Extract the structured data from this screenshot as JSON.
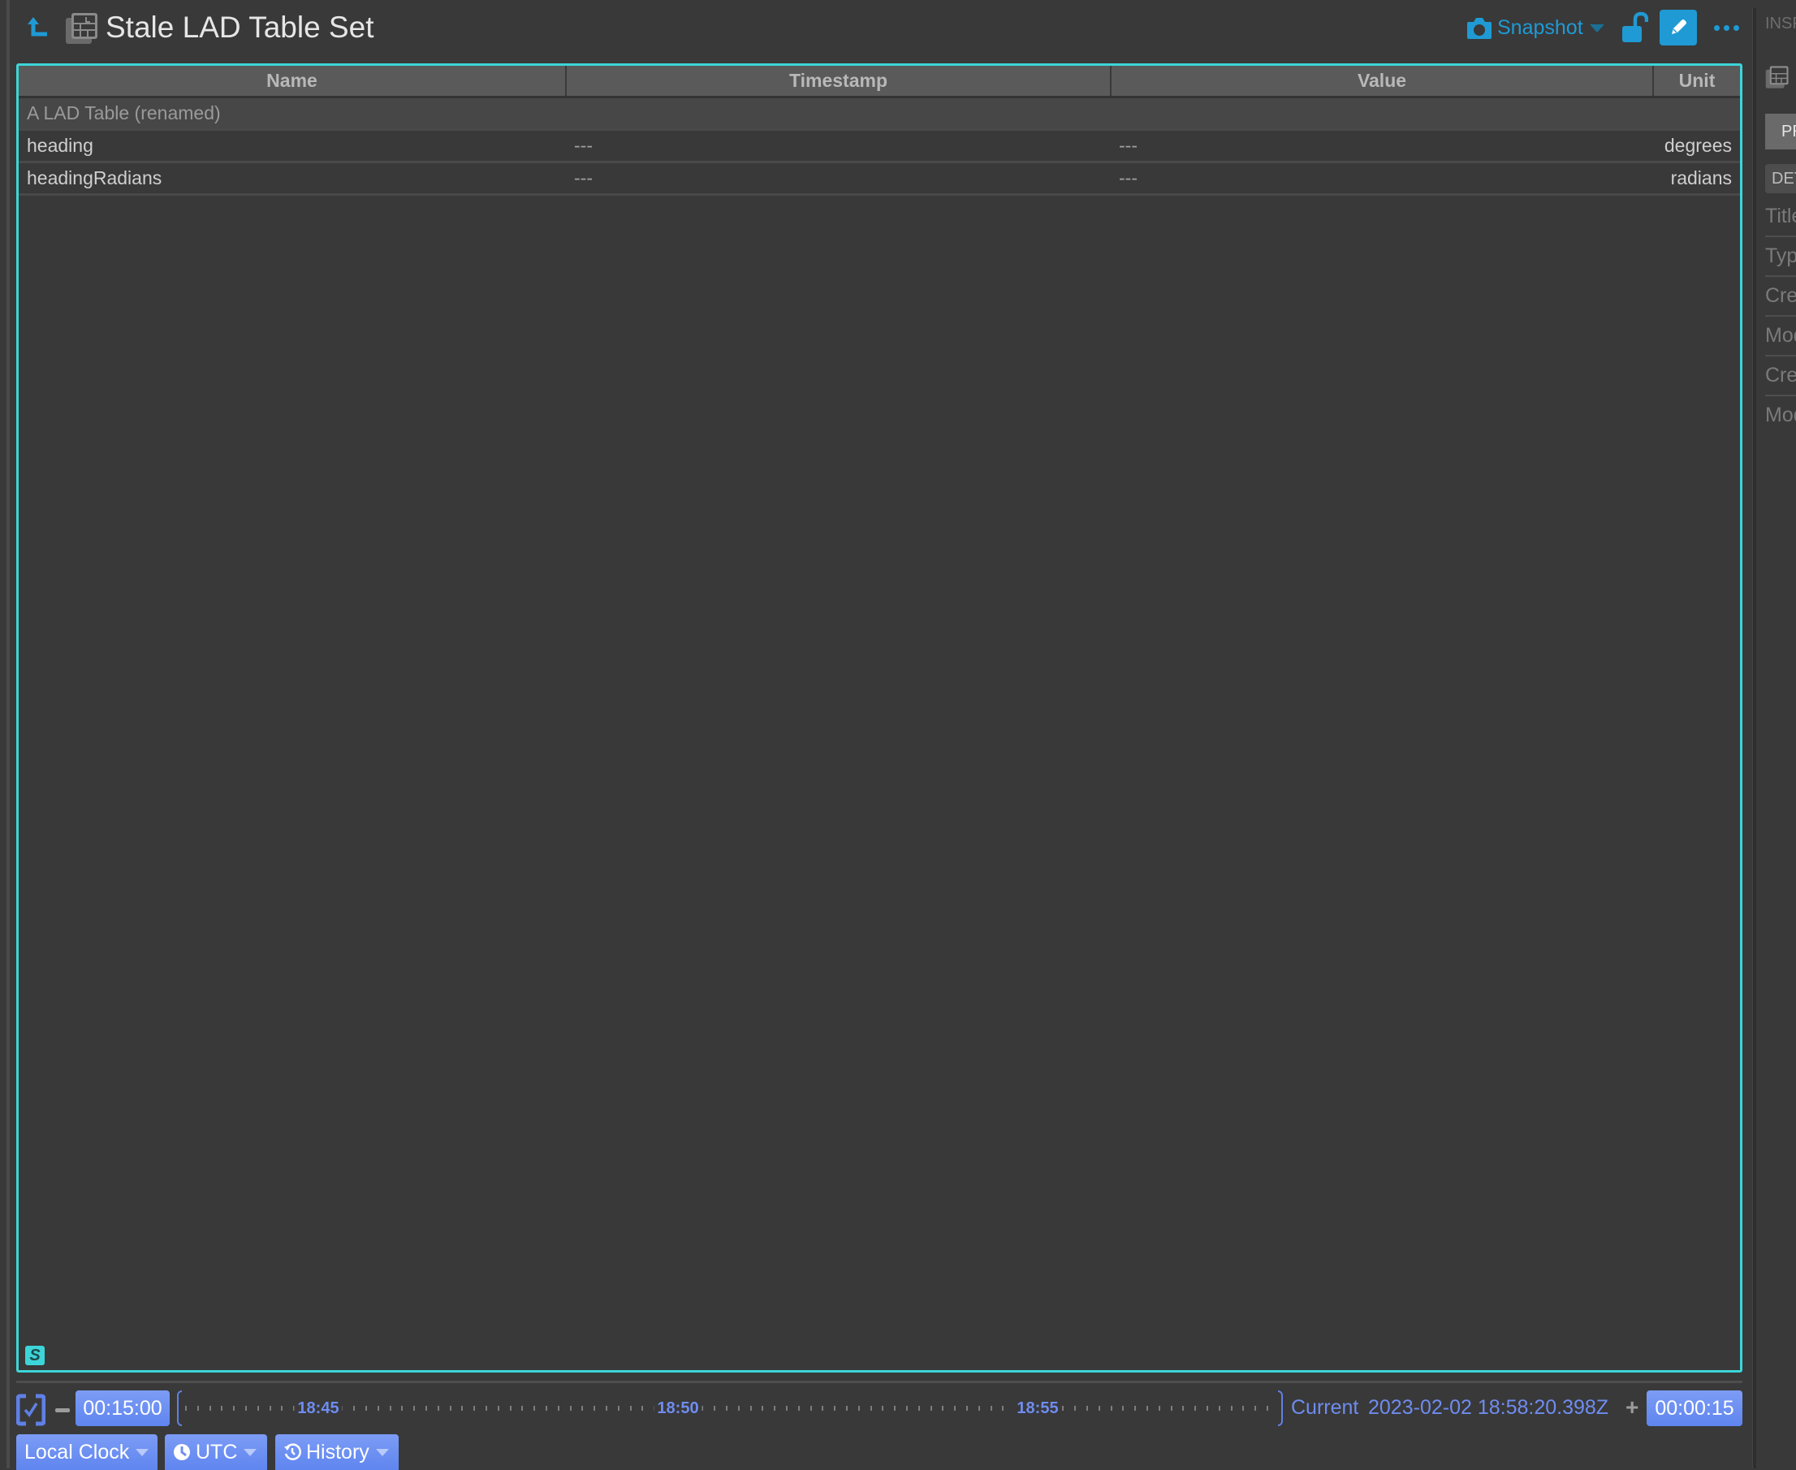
{
  "header": {
    "title": "Stale LAD Table Set",
    "snapshot_label": "Snapshot"
  },
  "inspector": {
    "title": "INSPECTOR",
    "tabs": [
      "PROPERTIES",
      "DETAILS"
    ],
    "property_rows": [
      "Title",
      "Type",
      "Created By",
      "Modified By",
      "Created",
      "Modified"
    ]
  },
  "table": {
    "columns": [
      "Name",
      "Timestamp",
      "Value",
      "Unit"
    ],
    "group_label": "A LAD Table (renamed)",
    "rows": [
      {
        "name": "heading",
        "timestamp": "---",
        "value": "---",
        "unit": "degrees"
      },
      {
        "name": "headingRadians",
        "timestamp": "---",
        "value": "---",
        "unit": "radians"
      }
    ],
    "status_badge": "S"
  },
  "time_conductor": {
    "start_offset": "00:15:00",
    "end_offset": "00:00:15",
    "axis_labels": [
      "18:45",
      "18:50",
      "18:55"
    ],
    "current_label": "Current",
    "current_value": "2023-02-02 18:58:20.398Z",
    "clock_menu": "Local Clock",
    "timesystem_menu": "UTC",
    "history_menu": "History"
  },
  "colors": {
    "accent_blue": "#1f9ad4",
    "selection_cyan": "#3dd5d8",
    "time_blue": "#6f8cf0"
  }
}
